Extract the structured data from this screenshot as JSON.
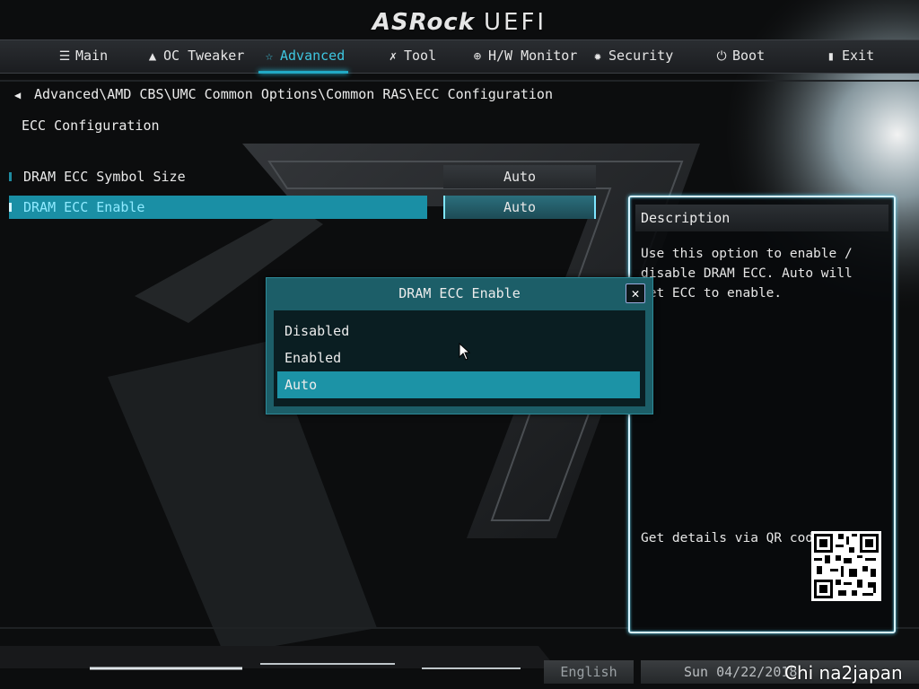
{
  "app": {
    "brand": "ASRock",
    "product": "UEFI"
  },
  "nav": [
    {
      "label": "Main",
      "icon": "list-icon"
    },
    {
      "label": "OC Tweaker",
      "icon": "rocket-icon"
    },
    {
      "label": "Advanced",
      "icon": "star-icon",
      "active": true
    },
    {
      "label": "Tool",
      "icon": "tools-icon"
    },
    {
      "label": "H/W Monitor",
      "icon": "crosshair-icon"
    },
    {
      "label": "Security",
      "icon": "shield-icon"
    },
    {
      "label": "Boot",
      "icon": "power-icon"
    },
    {
      "label": "Exit",
      "icon": "exit-door-icon"
    }
  ],
  "breadcrumb": "Advanced\\AMD CBS\\UMC Common Options\\Common RAS\\ECC Configuration",
  "section_title": "ECC Configuration",
  "settings": [
    {
      "label": "DRAM ECC Symbol Size",
      "value": "Auto"
    },
    {
      "label": "DRAM ECC Enable",
      "value": "Auto",
      "selected": true
    }
  ],
  "description": {
    "title": "Description",
    "text": "Use this option to enable / disable DRAM ECC. Auto will set ECC to enable.",
    "qr_label": "Get details via QR code"
  },
  "popup": {
    "title": "DRAM ECC Enable",
    "options": [
      "Disabled",
      "Enabled",
      "Auto"
    ],
    "selected": "Auto"
  },
  "footer": {
    "language": "English",
    "datetime": "Sun 04/22/2018"
  },
  "watermark": "Chi na2japan",
  "colors": {
    "accent": "#1c93a6",
    "highlight_text": "#8feaff",
    "panel_border": "#d8f4ff"
  }
}
